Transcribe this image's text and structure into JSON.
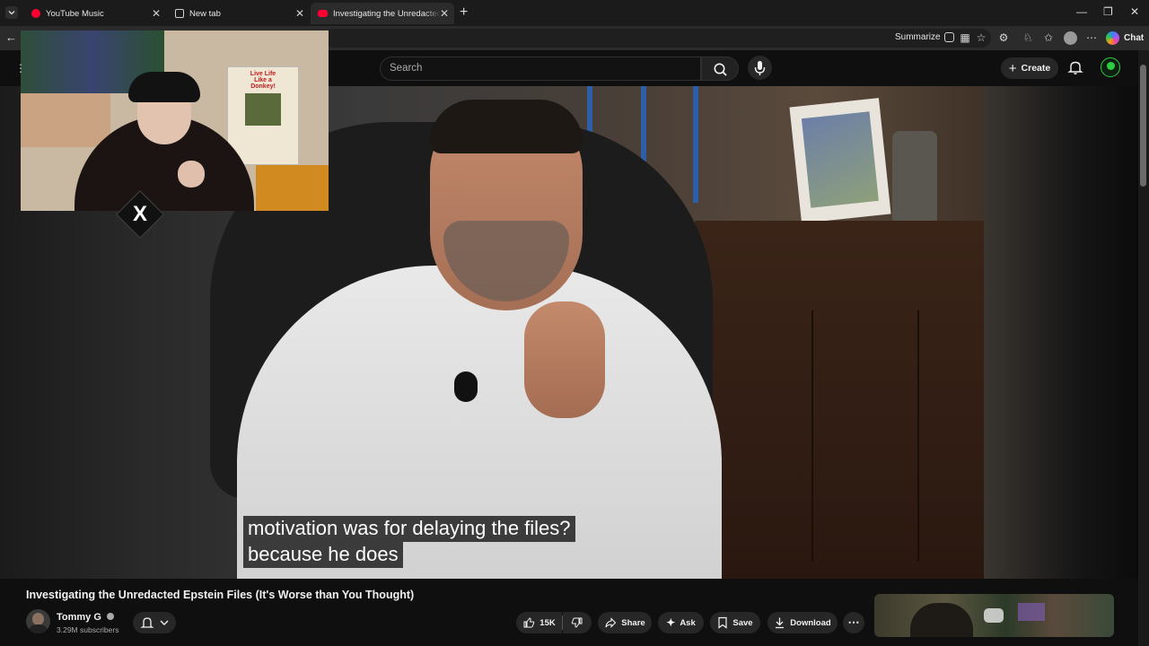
{
  "browser": {
    "tabs": [
      {
        "label": "YouTube Music",
        "active": false
      },
      {
        "label": "New tab",
        "active": false
      },
      {
        "label": "Investigating the Unredacted Epstein Files",
        "active": true
      }
    ],
    "toolbar": {
      "summarize_label": "Summarize",
      "chat_label": "Chat"
    }
  },
  "youtube": {
    "search_placeholder": "Search",
    "create_label": "Create"
  },
  "player": {
    "captions": [
      "motivation was for delaying the files?",
      "because he does"
    ]
  },
  "webcam": {
    "poster_text": [
      "Live Life",
      "Like a",
      "Donkey!"
    ],
    "brand_mark": "X"
  },
  "video": {
    "title": "Investigating the Unredacted Epstein Files (It's Worse than You Thought)",
    "channel_name": "Tommy G",
    "subscribers": "3.29M subscribers",
    "like_count": "15K",
    "share_label": "Share",
    "ask_label": "Ask",
    "save_label": "Save",
    "download_label": "Download"
  },
  "colors": {
    "youtube_red": "#ff0033",
    "channel_avatar_green": "#2ecc40",
    "caption_bg": "#080808"
  },
  "icons": [
    "tab-list-icon",
    "youtube-music-icon",
    "new-tab-icon",
    "youtube-icon",
    "plus-icon",
    "minimize-icon",
    "maximize-icon",
    "close-icon",
    "back-icon",
    "summarize-icon",
    "reading-view-icon",
    "favorite-star-icon",
    "extensions-icon",
    "browser-essentials-icon",
    "favorites-icon",
    "profile-icon",
    "more-icon",
    "copilot-icon",
    "menu-icon",
    "search-icon",
    "mic-icon",
    "bell-icon",
    "verified-icon",
    "chevron-down-icon",
    "like-icon",
    "dislike-icon",
    "share-icon",
    "sparkle-icon",
    "bookmark-icon",
    "download-icon",
    "ellipsis-icon"
  ]
}
